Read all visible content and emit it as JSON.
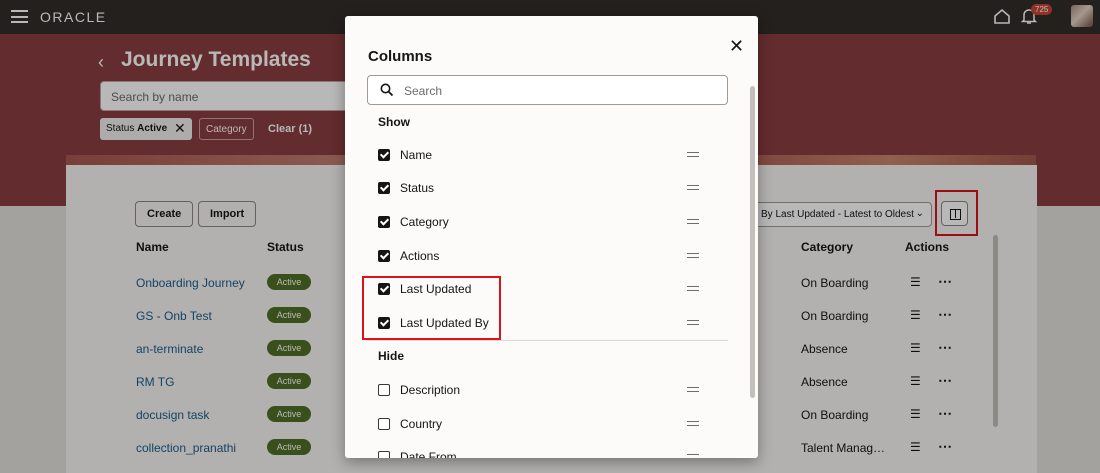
{
  "topbar": {
    "logo": "ORACLE",
    "notification_count": "725"
  },
  "page": {
    "title": "Journey Templates",
    "search_placeholder": "Search by name",
    "filters": {
      "status_label": "Status",
      "status_value": "Active",
      "category_label": "Category",
      "clear_label": "Clear (1)"
    }
  },
  "toolbar": {
    "create_label": "Create",
    "import_label": "Import",
    "sort_label": "By Last Updated - Latest to Oldest"
  },
  "table": {
    "headers": {
      "name": "Name",
      "status": "Status",
      "category": "Category",
      "actions": "Actions"
    },
    "rows": [
      {
        "name": "Onboarding Journey",
        "status": "Active",
        "category": "On Boarding"
      },
      {
        "name": "GS - Onb Test",
        "status": "Active",
        "category": "On Boarding"
      },
      {
        "name": "an-terminate",
        "status": "Active",
        "category": "Absence"
      },
      {
        "name": "RM TG",
        "status": "Active",
        "category": "Absence"
      },
      {
        "name": "docusign task",
        "status": "Active",
        "category": "On Boarding"
      },
      {
        "name": "collection_pranathi",
        "status": "Active",
        "category": "Talent Manag…"
      }
    ]
  },
  "dialog": {
    "title": "Columns",
    "search_placeholder": "Search",
    "show_label": "Show",
    "hide_label": "Hide",
    "show_items": [
      "Name",
      "Status",
      "Category",
      "Actions",
      "Last Updated",
      "Last Updated By"
    ],
    "hide_items": [
      "Description",
      "Country",
      "Date From"
    ]
  },
  "colors": {
    "brand_band": "#8a3d41",
    "topbar": "#312d2a",
    "status_pill": "#4f6f27",
    "link": "#1a5e8c",
    "highlight": "#d9141c"
  }
}
